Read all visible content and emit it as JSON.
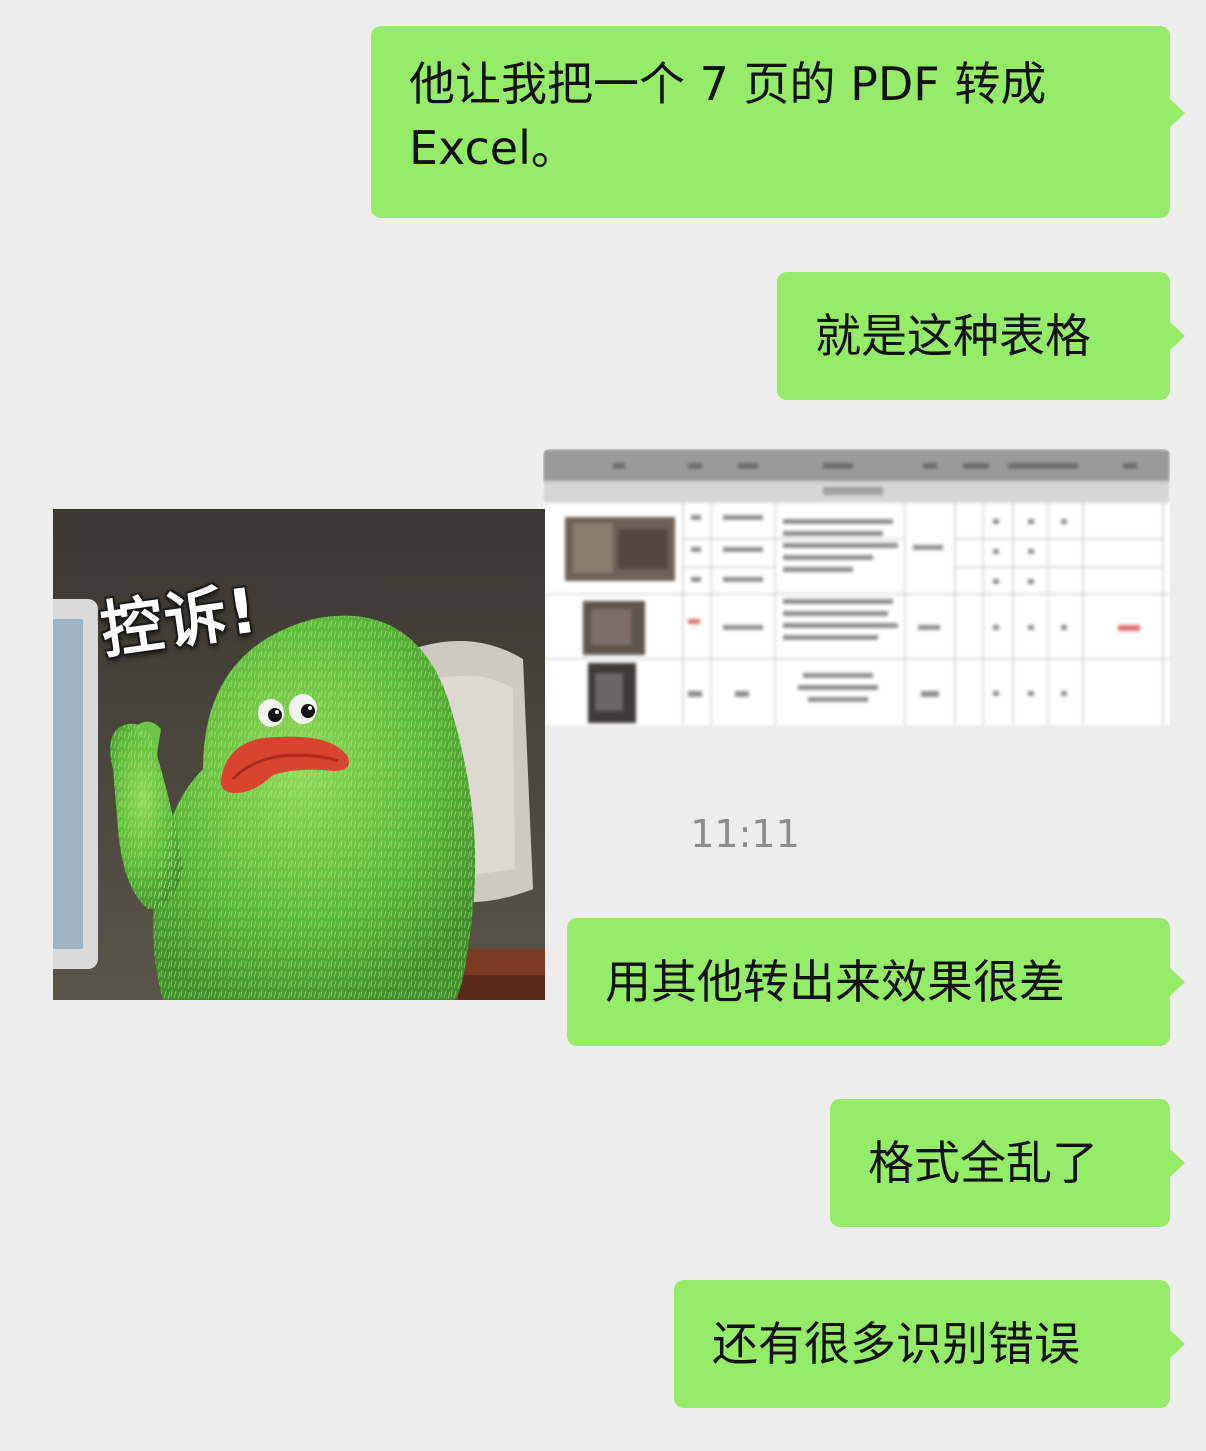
{
  "messages": [
    {
      "text": "他让我把一个 7 页的 PDF 转成\nExcel。"
    },
    {
      "text": "就是这种表格"
    },
    {
      "text": "用其他转出来效果很差"
    },
    {
      "text": "格式全乱了"
    },
    {
      "text": "还有很多识别错误"
    }
  ],
  "sticker": {
    "caption": "控诉!"
  },
  "timestamp": "11:11",
  "colors": {
    "background": "#ededed",
    "bubble_outgoing": "#95ec69",
    "timestamp": "#8c8c8c"
  }
}
